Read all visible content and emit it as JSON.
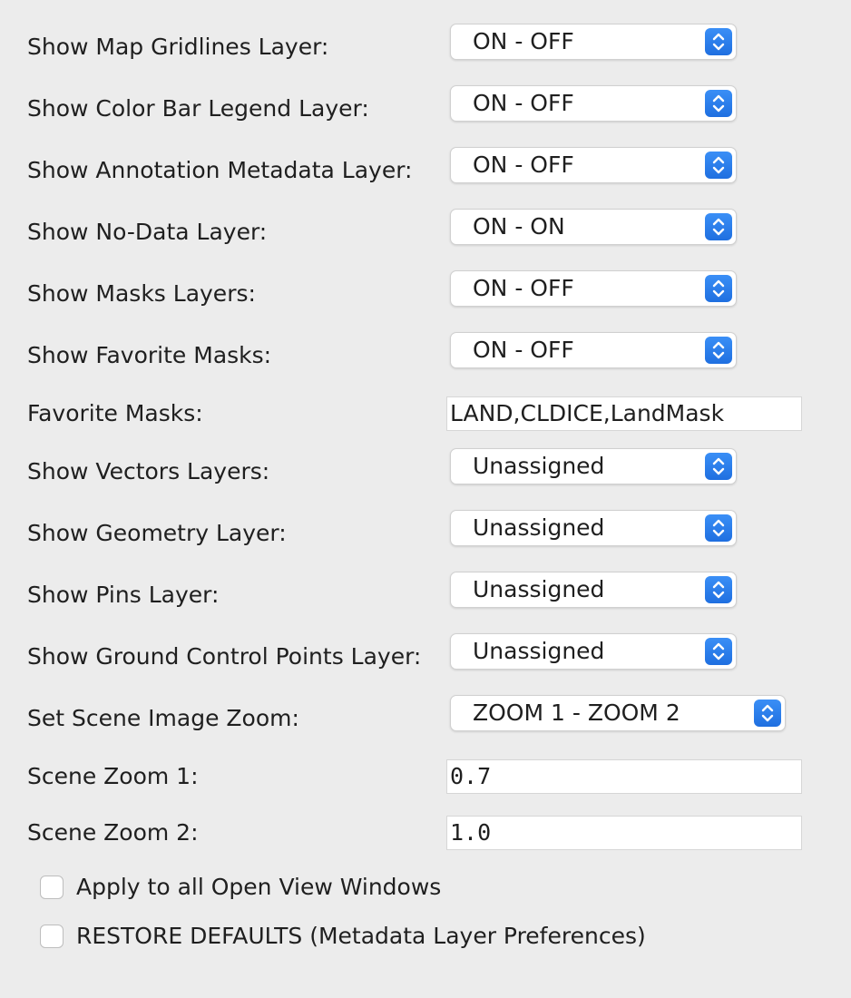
{
  "rows": [
    {
      "label": "Show Map Gridlines Layer:",
      "value": "ON - OFF"
    },
    {
      "label": "Show Color Bar Legend Layer:",
      "value": "ON - OFF"
    },
    {
      "label": "Show Annotation Metadata Layer:",
      "value": "ON - OFF"
    },
    {
      "label": "Show No-Data Layer:",
      "value": "ON - ON"
    },
    {
      "label": "Show Masks Layers:",
      "value": "ON - OFF"
    },
    {
      "label": "Show Favorite Masks:",
      "value": "ON - OFF"
    },
    {
      "label": "Favorite Masks:",
      "value": "LAND,CLDICE,LandMask"
    },
    {
      "label": "Show Vectors Layers:",
      "value": "Unassigned"
    },
    {
      "label": "Show Geometry Layer:",
      "value": "Unassigned"
    },
    {
      "label": "Show Pins Layer:",
      "value": "Unassigned"
    },
    {
      "label": "Show Ground Control Points Layer:",
      "value": "Unassigned"
    },
    {
      "label": "Set Scene Image Zoom:",
      "value": "ZOOM 1 - ZOOM 2"
    },
    {
      "label": "Scene Zoom 1:",
      "value": "0.7"
    },
    {
      "label": "Scene Zoom 2:",
      "value": "1.0"
    }
  ],
  "checkboxes": [
    {
      "label": "Apply to all Open View Windows",
      "checked": false
    },
    {
      "label": "RESTORE DEFAULTS (Metadata Layer Preferences)",
      "checked": false
    }
  ],
  "colors": {
    "background": "#ececec",
    "stepper_accent": "#2a7ff0"
  },
  "icons": {
    "stepper": "up-down-chevron-icon"
  }
}
